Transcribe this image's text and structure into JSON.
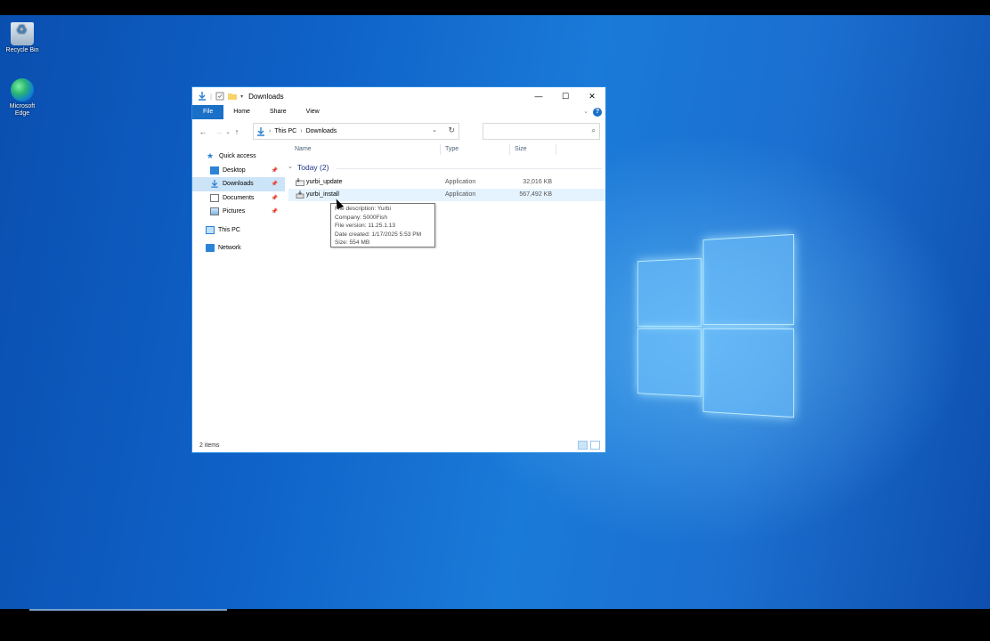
{
  "desktop": {
    "icons": [
      {
        "label": "Recycle Bin"
      },
      {
        "label": "Microsoft Edge"
      }
    ]
  },
  "window": {
    "title": "Downloads",
    "controls": {
      "minimize": "—",
      "maximize": "☐",
      "close": "✕"
    },
    "ribbon": {
      "tabs": [
        "File",
        "Home",
        "Share",
        "View"
      ],
      "help": "?"
    },
    "address": {
      "crumbs": [
        "This PC",
        "Downloads"
      ]
    },
    "search": {
      "placeholder": ""
    },
    "nav_pane": {
      "items": [
        {
          "label": "Quick access"
        },
        {
          "label": "Desktop"
        },
        {
          "label": "Downloads"
        },
        {
          "label": "Documents"
        },
        {
          "label": "Pictures"
        },
        {
          "label": "This PC"
        },
        {
          "label": "Network"
        }
      ]
    },
    "columns": {
      "name": "Name",
      "type": "Type",
      "size": "Size"
    },
    "group": {
      "label": "Today (2)"
    },
    "files": [
      {
        "name": "yurbi_update",
        "type": "Application",
        "size": "32,016 KB"
      },
      {
        "name": "yurbi_install",
        "type": "Application",
        "size": "567,492 KB"
      }
    ],
    "tooltip": {
      "lines": [
        "File description: Yurbi",
        "Company: 5000Fish",
        "File version: 11.25.1.13",
        "Date created: 1/17/2025 5:53 PM",
        "Size: 554 MB"
      ]
    },
    "status": {
      "items": "2 items"
    }
  },
  "colors": {
    "accent": "#1a6fc7",
    "selection": "#cce4f7",
    "hover": "#e5f3ff"
  }
}
